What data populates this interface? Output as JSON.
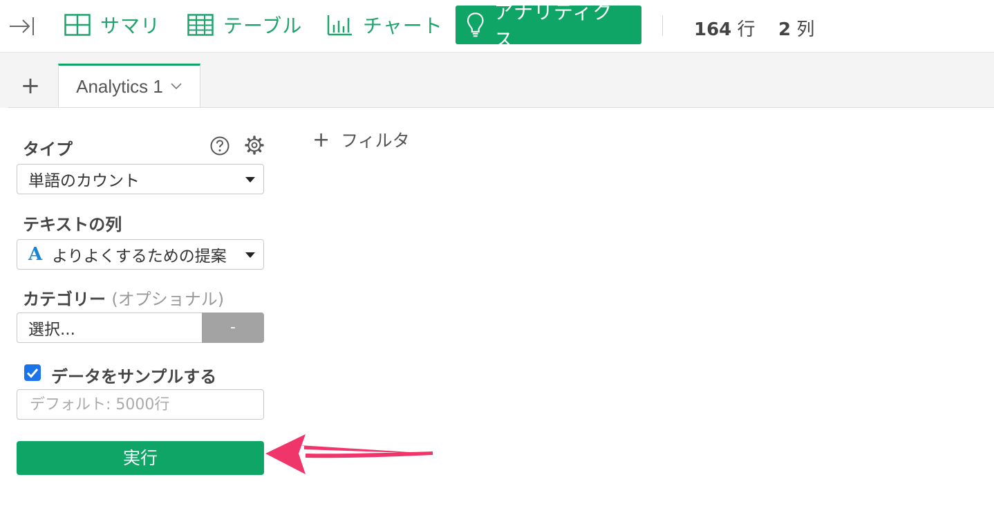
{
  "toolbar": {
    "nav": [
      {
        "label": "サマリ",
        "icon": "summary-grid-icon"
      },
      {
        "label": "テーブル",
        "icon": "table-icon"
      },
      {
        "label": "チャート",
        "icon": "bar-chart-icon"
      },
      {
        "label": "アナリティクス",
        "icon": "lightbulb-icon",
        "active": true
      }
    ],
    "rows_count": "164",
    "rows_unit": "行",
    "cols_count": "2",
    "cols_unit": "列"
  },
  "tabs": {
    "add_label": "+",
    "items": [
      {
        "label": "Analytics 1",
        "active": true
      }
    ]
  },
  "panel": {
    "type_label": "タイプ",
    "type_value": "単語のカウント",
    "text_col_label": "テキストの列",
    "text_col_type_icon": "A",
    "text_col_value": "よりよくするための提案",
    "category_label": "カテゴリー",
    "category_optional": "(オプショナル)",
    "category_placeholder": "選択...",
    "category_clear": "-",
    "sample_label": "データをサンプルする",
    "sample_checked": true,
    "sample_placeholder": "デフォルト: 5000行",
    "run_label": "実行"
  },
  "filter": {
    "label": "フィルタ",
    "plus": "+"
  },
  "colors": {
    "accent_green": "#0ea567",
    "nav_text_green": "#1fa36c",
    "checkbox_blue": "#1a73e8",
    "annotation_arrow": "#f0356b"
  }
}
